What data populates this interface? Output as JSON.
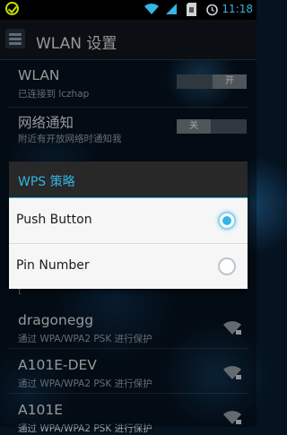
{
  "status_bar": {
    "time": "11:18",
    "icons": [
      "check-icon",
      "wifi-icon",
      "signal-icon",
      "sd-card-icon",
      "alarm-icon"
    ],
    "accent": "#33b5e5"
  },
  "action_bar": {
    "title": "WLAN 设置",
    "icon": "settings-icon"
  },
  "settings": {
    "wlan": {
      "label": "WLAN",
      "status": "已连接到 lczhap",
      "toggle": "开"
    },
    "notify": {
      "label": "网络通知",
      "status": "附近有开放网络时通知我",
      "toggle": "关"
    },
    "partial_row_text": "t"
  },
  "dialog": {
    "title": "WPS 策略",
    "options": [
      {
        "label": "Push Button",
        "selected": true
      },
      {
        "label": "Pin Number",
        "selected": false
      }
    ]
  },
  "networks": [
    {
      "ssid": "dragonegg",
      "security": "通过 WPA/WPA2 PSK 进行保护"
    },
    {
      "ssid": "A101E-DEV",
      "security": "通过 WPA/WPA2 PSK 进行保护"
    },
    {
      "ssid": "A101E",
      "security": "通过 WPA/WPA2 PSK 进行保护"
    }
  ]
}
